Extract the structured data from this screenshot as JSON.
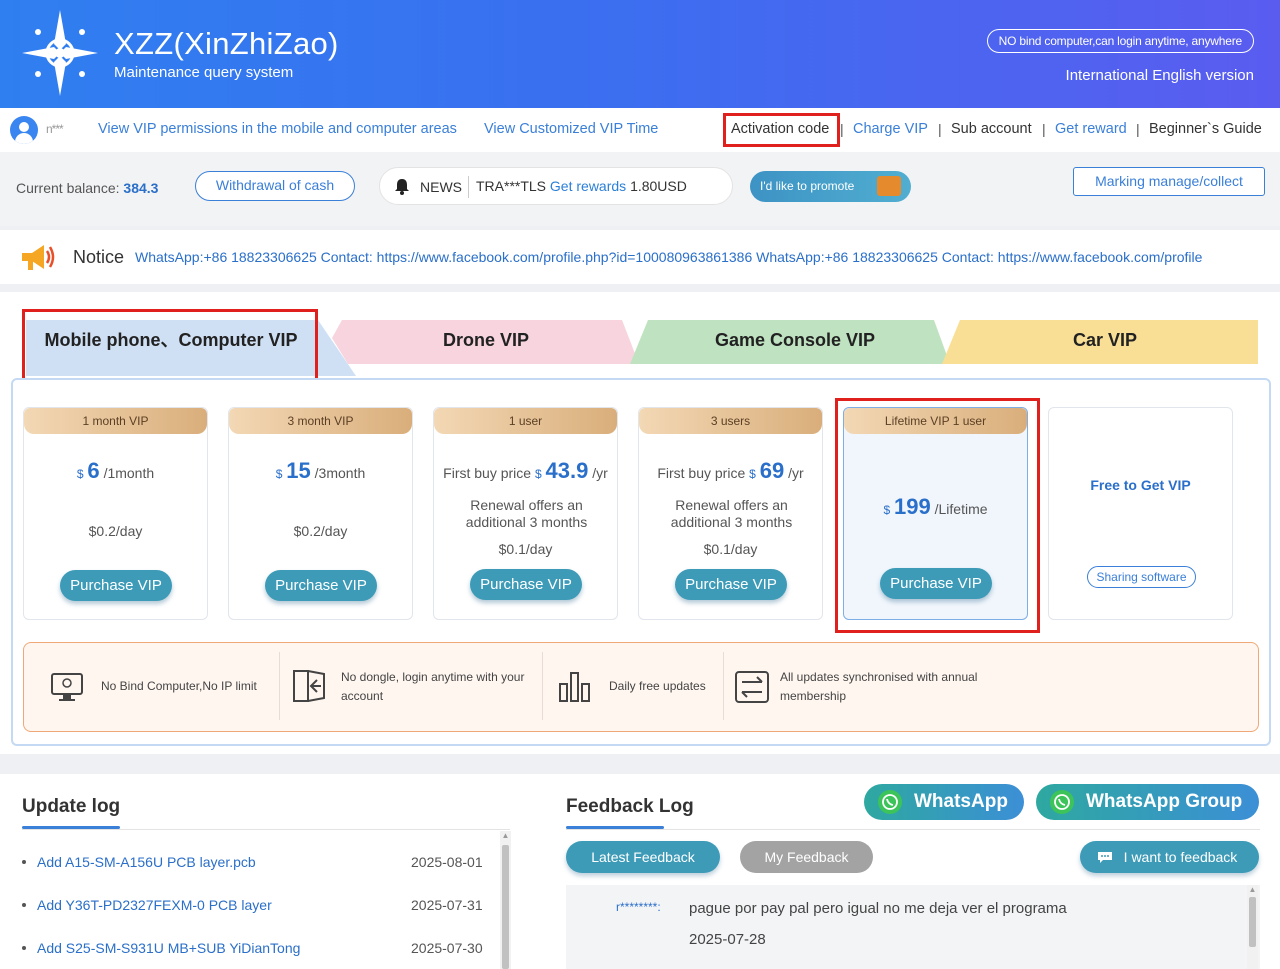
{
  "header": {
    "app_title": "XZZ(XinZhiZao)",
    "app_subtitle": "Maintenance query system",
    "pill_text": "NO bind computer,can login anytime, anywhere",
    "language": "International English version"
  },
  "nav": {
    "username": "n***",
    "links": [
      "View VIP permissions in the mobile and computer areas",
      "View Customized VIP Time",
      "Activation code",
      "Charge VIP",
      "Sub account",
      "Get reward",
      "Beginner`s Guide"
    ],
    "separator": "|"
  },
  "balance": {
    "label": "Current balance:",
    "value": "384.3",
    "withdraw_label": "Withdrawal of cash",
    "news_label": "NEWS",
    "news_user": "TRA***TLS",
    "news_action": "Get rewards",
    "news_amount": "1.80USD",
    "promote_label": "I'd like to promote",
    "marking_label": "Marking manage/collect"
  },
  "notice": {
    "label": "Notice",
    "text": "WhatsApp:+86 18823306625 Contact: https://www.facebook.com/profile.php?id=100080963861386 WhatsApp:+86 18823306625 Contact: https://www.facebook.com/profile"
  },
  "tabs": [
    "Mobile phone、Computer VIP",
    "Drone VIP",
    "Game Console VIP",
    "Car VIP"
  ],
  "plans": [
    {
      "ribbon": "1 month VIP",
      "prefix": "",
      "currency": "$",
      "price": "6",
      "suffix": "/1month",
      "note": "",
      "perday": "$0.2/day",
      "button": "Purchase VIP"
    },
    {
      "ribbon": "3 month VIP",
      "prefix": "",
      "currency": "$",
      "price": "15",
      "suffix": "/3month",
      "note": "",
      "perday": "$0.2/day",
      "button": "Purchase VIP"
    },
    {
      "ribbon": "1 user",
      "prefix": "First buy price",
      "currency": "$",
      "price": "43.9",
      "suffix": "/yr",
      "note": "Renewal offers an additional 3 months",
      "perday": "$0.1/day",
      "button": "Purchase VIP"
    },
    {
      "ribbon": "3 users",
      "prefix": "First buy price",
      "currency": "$",
      "price": "69",
      "suffix": "/yr",
      "note": "Renewal offers an additional 3 months",
      "perday": "$0.1/day",
      "button": "Purchase VIP"
    },
    {
      "ribbon": "Lifetime VIP 1 user",
      "prefix": "",
      "currency": "$",
      "price": "199",
      "suffix": "/Lifetime",
      "note": "",
      "perday": "",
      "button": "Purchase VIP"
    }
  ],
  "free_card": {
    "title": "Free to Get VIP",
    "button": "Sharing software"
  },
  "features": [
    {
      "icon": "monitor-icon",
      "text": "No Bind Computer,No IP limit"
    },
    {
      "icon": "login-icon",
      "text": "No dongle, login anytime with your account"
    },
    {
      "icon": "chart-icon",
      "text": "Daily free updates"
    },
    {
      "icon": "sync-icon",
      "text": "All updates synchronised with annual membership"
    }
  ],
  "update_log": {
    "title": "Update log",
    "items": [
      {
        "text": "Add A15-SM-A156U PCB layer.pcb",
        "date": "2025-08-01"
      },
      {
        "text": "Add Y36T-PD2327FEXM-0 PCB layer",
        "date": "2025-07-31"
      },
      {
        "text": "Add S25-SM-S931U MB+SUB YiDianTong",
        "date": "2025-07-30"
      }
    ]
  },
  "feedback": {
    "title": "Feedback Log",
    "whatsapp": "WhatsApp",
    "whatsapp_group": "WhatsApp Group",
    "latest": "Latest Feedback",
    "mine": "My Feedback",
    "want": "I want to feedback",
    "entry_user": "r********:",
    "entry_text": "pague por pay pal pero igual no me deja ver el programa",
    "entry_date": "2025-07-28"
  },
  "colors": {
    "accent": "#3a7fd8",
    "highlight": "#e0201c",
    "button": "#3d9bb8"
  }
}
